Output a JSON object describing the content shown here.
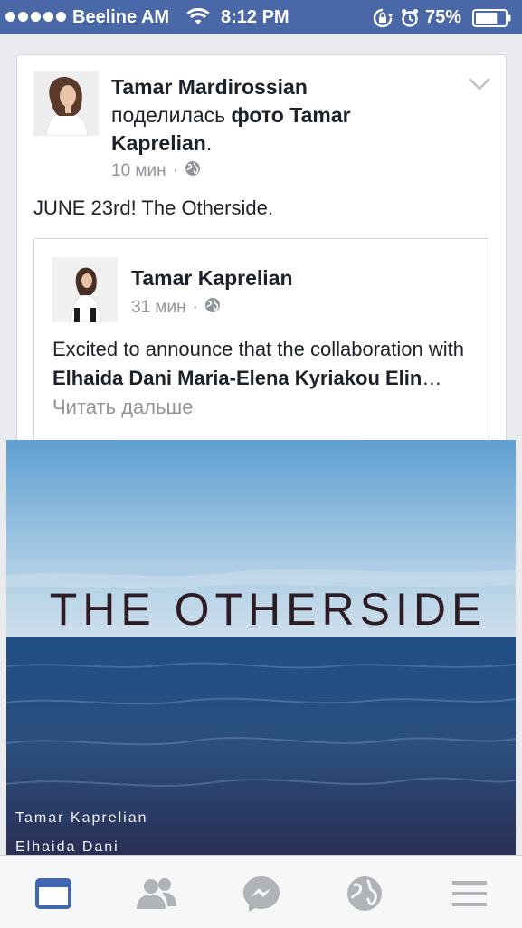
{
  "status_bar": {
    "carrier": "Beeline AM",
    "time": "8:12 PM",
    "battery_percent": "75%",
    "battery_level": 0.75,
    "signal_dots": 5,
    "icons": [
      "wifi-icon",
      "rotation-lock-icon",
      "alarm-icon",
      "battery-icon"
    ]
  },
  "post": {
    "author": "Tamar Mardirossian",
    "action_text": "поделилась",
    "shared_object": "фото Tamar Kaprelian",
    "punct": ".",
    "time": "10 мин",
    "separator": "·",
    "privacy_icon": "globe-icon",
    "text": "JUNE 23rd! The Otherside."
  },
  "shared": {
    "author": "Tamar Kaprelian",
    "time": "31 мин",
    "separator": "·",
    "privacy_icon": "globe-icon",
    "text_before": "Excited to announce that the collaboration with ",
    "text_bold": "Elhaida Dani Maria-Elena Kyriakou Elin",
    "ellipsis": "…",
    "read_more": "Читать дальше"
  },
  "photo": {
    "title": "THE OTHERSIDE",
    "credit_1": "Tamar Kaprelian",
    "credit_2": "Elhaida Dani"
  },
  "tab_bar": {
    "tabs": [
      "news-feed-icon",
      "friends-icon",
      "messenger-icon",
      "globe-icon",
      "menu-icon"
    ],
    "active": "news-feed-icon",
    "active_color": "#4267b2",
    "inactive_color": "#b0b3b8"
  }
}
